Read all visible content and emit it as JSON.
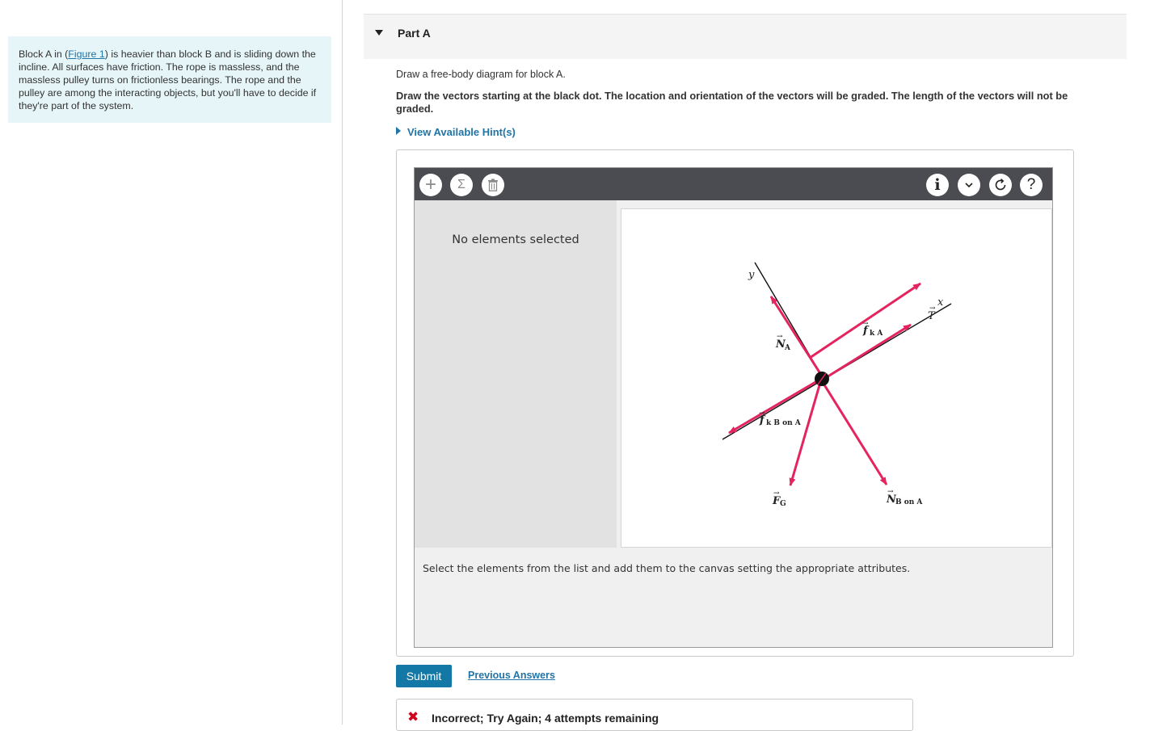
{
  "problem": {
    "text_before": "Block A in (",
    "figure_link": "Figure 1",
    "text_after": ") is heavier than block B and is sliding down the incline. All surfaces have friction. The rope is massless, and the massless pulley turns on frictionless bearings. The rope and the pulley are among the interacting objects, but you'll have to decide if they're part of the system."
  },
  "part": {
    "title": "Part A",
    "instruction": "Draw a free-body diagram for block A.",
    "instruction_bold": "Draw the vectors starting at the black dot. The location and orientation of the vectors will be graded. The length of the vectors will not be graded.",
    "hint_link": "View Available Hint(s)"
  },
  "toolbar": {
    "left_icons": [
      "plus-icon",
      "sigma-icon",
      "trash-icon"
    ],
    "right_icons": [
      "info-icon",
      "chevron-down-icon",
      "reset-icon",
      "help-icon"
    ],
    "plus_glyph": "+",
    "sigma_glyph": "Σ",
    "info_glyph": "i",
    "chevron_glyph": "⌄",
    "help_glyph": "?"
  },
  "side_panel": {
    "message": "No elements selected"
  },
  "canvas": {
    "axis_labels": {
      "x": "x",
      "y": "y"
    },
    "vector_color": "#e5245f",
    "vectors": [
      {
        "id": "fkA",
        "symbol": "f",
        "sub": "k A"
      },
      {
        "id": "T",
        "symbol": "T",
        "sub": ""
      },
      {
        "id": "NA",
        "symbol": "N",
        "sub": "A"
      },
      {
        "id": "fkBonA",
        "symbol": "f",
        "sub": "k B on A"
      },
      {
        "id": "FG",
        "symbol": "F",
        "sub": "G"
      },
      {
        "id": "NBonA",
        "symbol": "N",
        "sub": "B on A"
      }
    ]
  },
  "select_message": "Select the elements from the list and add them to the canvas setting the appropriate attributes.",
  "actions": {
    "submit": "Submit",
    "previous_answers": "Previous Answers"
  },
  "feedback": {
    "icon": "✖",
    "text": "Incorrect; Try Again; 4 attempts remaining"
  },
  "colors": {
    "accent": "#1378a6",
    "link": "#1f74a8",
    "error": "#d0021b",
    "toolbar": "#4b4c51"
  }
}
